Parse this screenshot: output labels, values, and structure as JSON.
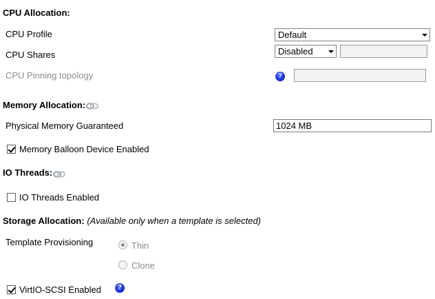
{
  "cpu": {
    "title": "CPU Allocation:",
    "profile_label": "CPU Profile",
    "profile_value": "Default",
    "shares_label": "CPU Shares",
    "shares_value": "Disabled",
    "shares_input_value": "",
    "pinning_label": "CPU Pinning topology",
    "pinning_value": "",
    "pinning_help_icon": "help-icon"
  },
  "memory": {
    "title": "Memory Allocation:",
    "title_icon": "link-icon",
    "guaranteed_label": "Physical Memory Guaranteed",
    "guaranteed_value": "1024 MB",
    "balloon_label": "Memory Balloon Device Enabled",
    "balloon_checked": true
  },
  "io": {
    "title": "IO Threads:",
    "title_icon": "link-icon",
    "threads_label": "IO Threads Enabled",
    "threads_checked": false
  },
  "storage": {
    "title": "Storage Allocation:",
    "note": "(Available only when a template is selected)",
    "provisioning_label": "Template Provisioning",
    "options": [
      {
        "label": "Thin",
        "selected": true
      },
      {
        "label": "Clone",
        "selected": false
      }
    ],
    "virtio_label": "VirtIO-SCSI Enabled",
    "virtio_checked": true,
    "virtio_help_icon": "help-icon"
  },
  "colors": {
    "disabled_text": "#8c8c8c",
    "help_icon": "#1428c8"
  }
}
